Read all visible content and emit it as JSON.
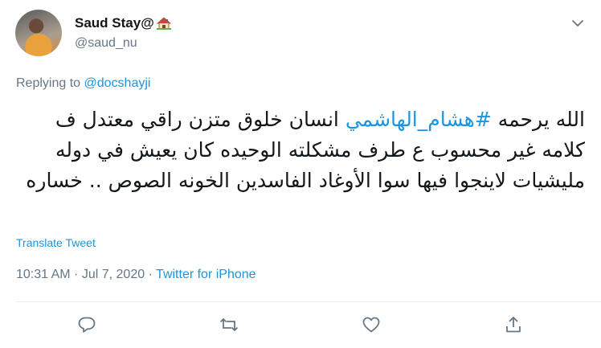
{
  "user": {
    "display_name": "Saud Stay@",
    "handle": "@saud_nu",
    "name_emoji_icon": "house-icon"
  },
  "reply": {
    "prefix": "Replying to ",
    "mention": "@docshayji"
  },
  "tweet": {
    "text_before_hashtag": "الله يرحمه ",
    "hashtag": "#هشام_الهاشمي",
    "text_after_hashtag": " انسان خلوق متزن راقي معتدل ف كلامه غير محسوب ع طرف مشكلته الوحيده كان يعيش في دوله مليشيات لاينجوا فيها سوا الأوغاد الفاسدين الخونه الصوص .. خساره"
  },
  "translate_label": "Translate Tweet",
  "meta": {
    "time": "10:31 AM",
    "separator1": " · ",
    "date": "Jul 7, 2020",
    "separator2": " · ",
    "source": "Twitter for iPhone"
  },
  "actions": [
    {
      "icon": "reply-icon"
    },
    {
      "icon": "retweet-icon"
    },
    {
      "icon": "like-icon"
    },
    {
      "icon": "share-icon"
    }
  ],
  "colors": {
    "link": "#1b95e0",
    "secondary": "#657786",
    "text": "#14171a",
    "divider": "#e6ecf0"
  }
}
